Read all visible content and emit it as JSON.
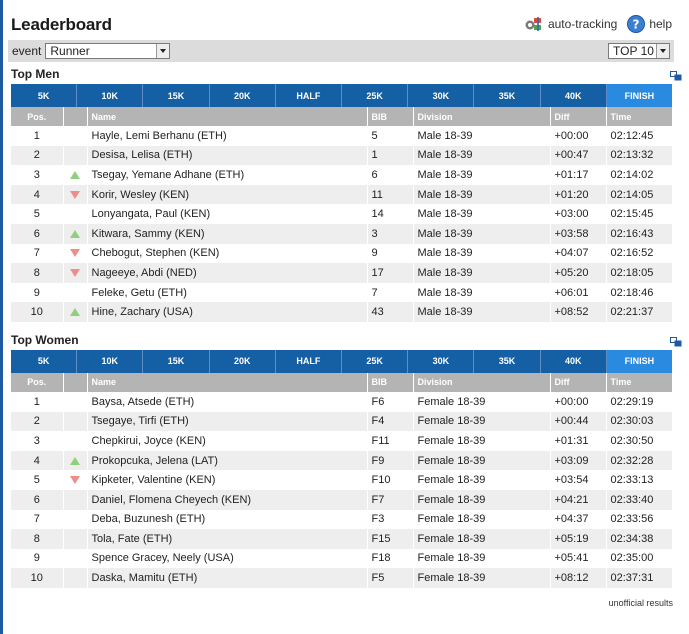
{
  "title": "Leaderboard",
  "tools": {
    "auto_tracking": "auto-tracking",
    "help": "help"
  },
  "filter": {
    "event_label": "event",
    "event_value": "Runner",
    "top_value": "TOP 10"
  },
  "tabs": [
    "5K",
    "10K",
    "15K",
    "20K",
    "HALF",
    "25K",
    "30K",
    "35K",
    "40K",
    "FINISH"
  ],
  "active_tab": "FINISH",
  "columns": [
    "Pos.",
    "",
    "Name",
    "BIB",
    "Division",
    "Diff",
    "Time"
  ],
  "men": {
    "title": "Top Men",
    "rows": [
      {
        "pos": "1",
        "trend": "",
        "name": "Hayle, Lemi Berhanu (ETH)",
        "bib": "5",
        "division": "Male 18-39",
        "diff": "+00:00",
        "time": "02:12:45"
      },
      {
        "pos": "2",
        "trend": "",
        "name": "Desisa, Lelisa (ETH)",
        "bib": "1",
        "division": "Male 18-39",
        "diff": "+00:47",
        "time": "02:13:32"
      },
      {
        "pos": "3",
        "trend": "up",
        "name": "Tsegay, Yemane Adhane (ETH)",
        "bib": "6",
        "division": "Male 18-39",
        "diff": "+01:17",
        "time": "02:14:02"
      },
      {
        "pos": "4",
        "trend": "down",
        "name": "Korir, Wesley (KEN)",
        "bib": "11",
        "division": "Male 18-39",
        "diff": "+01:20",
        "time": "02:14:05"
      },
      {
        "pos": "5",
        "trend": "",
        "name": "Lonyangata, Paul (KEN)",
        "bib": "14",
        "division": "Male 18-39",
        "diff": "+03:00",
        "time": "02:15:45"
      },
      {
        "pos": "6",
        "trend": "up",
        "name": "Kitwara, Sammy (KEN)",
        "bib": "3",
        "division": "Male 18-39",
        "diff": "+03:58",
        "time": "02:16:43"
      },
      {
        "pos": "7",
        "trend": "down",
        "name": "Chebogut, Stephen (KEN)",
        "bib": "9",
        "division": "Male 18-39",
        "diff": "+04:07",
        "time": "02:16:52"
      },
      {
        "pos": "8",
        "trend": "down",
        "name": "Nageeye, Abdi (NED)",
        "bib": "17",
        "division": "Male 18-39",
        "diff": "+05:20",
        "time": "02:18:05"
      },
      {
        "pos": "9",
        "trend": "",
        "name": "Feleke, Getu (ETH)",
        "bib": "7",
        "division": "Male 18-39",
        "diff": "+06:01",
        "time": "02:18:46"
      },
      {
        "pos": "10",
        "trend": "up",
        "name": "Hine, Zachary (USA)",
        "bib": "43",
        "division": "Male 18-39",
        "diff": "+08:52",
        "time": "02:21:37"
      }
    ]
  },
  "women": {
    "title": "Top Women",
    "rows": [
      {
        "pos": "1",
        "trend": "",
        "name": "Baysa, Atsede (ETH)",
        "bib": "F6",
        "division": "Female 18-39",
        "diff": "+00:00",
        "time": "02:29:19"
      },
      {
        "pos": "2",
        "trend": "",
        "name": "Tsegaye, Tirfi (ETH)",
        "bib": "F4",
        "division": "Female 18-39",
        "diff": "+00:44",
        "time": "02:30:03"
      },
      {
        "pos": "3",
        "trend": "",
        "name": "Chepkirui, Joyce (KEN)",
        "bib": "F11",
        "division": "Female 18-39",
        "diff": "+01:31",
        "time": "02:30:50"
      },
      {
        "pos": "4",
        "trend": "up",
        "name": "Prokopcuka, Jelena (LAT)",
        "bib": "F9",
        "division": "Female 18-39",
        "diff": "+03:09",
        "time": "02:32:28"
      },
      {
        "pos": "5",
        "trend": "down",
        "name": "Kipketer, Valentine (KEN)",
        "bib": "F10",
        "division": "Female 18-39",
        "diff": "+03:54",
        "time": "02:33:13"
      },
      {
        "pos": "6",
        "trend": "",
        "name": "Daniel, Flomena Cheyech (KEN)",
        "bib": "F7",
        "division": "Female 18-39",
        "diff": "+04:21",
        "time": "02:33:40"
      },
      {
        "pos": "7",
        "trend": "",
        "name": "Deba, Buzunesh (ETH)",
        "bib": "F3",
        "division": "Female 18-39",
        "diff": "+04:37",
        "time": "02:33:56"
      },
      {
        "pos": "8",
        "trend": "",
        "name": "Tola, Fate (ETH)",
        "bib": "F15",
        "division": "Female 18-39",
        "diff": "+05:19",
        "time": "02:34:38"
      },
      {
        "pos": "9",
        "trend": "",
        "name": "Spence Gracey, Neely (USA)",
        "bib": "F18",
        "division": "Female 18-39",
        "diff": "+05:41",
        "time": "02:35:00"
      },
      {
        "pos": "10",
        "trend": "",
        "name": "Daska, Mamitu (ETH)",
        "bib": "F5",
        "division": "Female 18-39",
        "diff": "+08:12",
        "time": "02:37:31"
      }
    ]
  },
  "footer": "unofficial results"
}
